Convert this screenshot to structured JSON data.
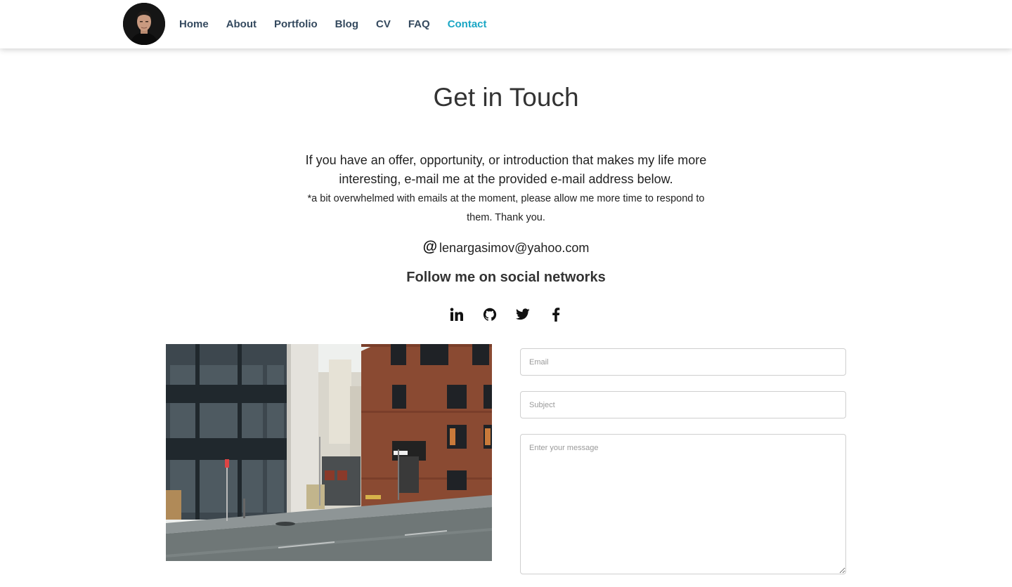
{
  "nav": {
    "links": [
      {
        "label": "Home",
        "active": false
      },
      {
        "label": "About",
        "active": false
      },
      {
        "label": "Portfolio",
        "active": false
      },
      {
        "label": "Blog",
        "active": false
      },
      {
        "label": "CV",
        "active": false
      },
      {
        "label": "FAQ",
        "active": false
      },
      {
        "label": "Contact",
        "active": true
      }
    ],
    "active_color": "#1aa6c4",
    "link_color": "#34495e"
  },
  "main": {
    "title": "Get in Touch",
    "intro": "If you have an offer, opportunity, or introduction that makes my life more interesting, e-mail me at the provided e-mail address below.",
    "note": "*a bit overwhelmed with emails at the moment, please allow me more time to respond to them. Thank you.",
    "email_icon": "@",
    "email": "lenargasimov@yahoo.com",
    "social_heading": "Follow me on social networks",
    "social": [
      {
        "icon": "linkedin-icon"
      },
      {
        "icon": "github-icon"
      },
      {
        "icon": "twitter-icon"
      },
      {
        "icon": "facebook-icon"
      }
    ]
  },
  "form": {
    "email_placeholder": "Email",
    "subject_placeholder": "Subject",
    "message_placeholder": "Enter your message"
  }
}
